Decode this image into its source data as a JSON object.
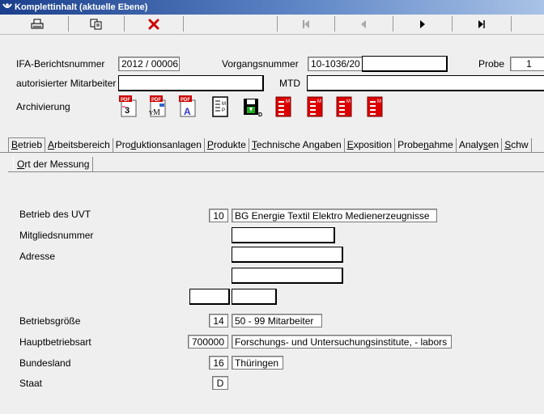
{
  "window": {
    "title": "Komplettinhalt (aktuelle Ebene)"
  },
  "toolbar": {
    "buttons": [
      "print-icon",
      "copy-record-icon",
      "delete-icon",
      "first-record-icon",
      "previous-record-icon",
      "next-record-icon",
      "last-record-icon"
    ],
    "delete_color": "#cc0000"
  },
  "header": {
    "ifa_label": "IFA-Berichtsnummer",
    "ifa_value": "2012 / 00006",
    "vorgang_label": "Vorgangsnummer",
    "vorgang_value": "10-1036/20",
    "probe_label": "Probe",
    "probe_value": "1",
    "mitarbeiter_label": "autorisierter Mitarbeiter",
    "mitarbeiter_value": "",
    "mtd_label": "MTD",
    "mtd_value": "",
    "archiv_label": "Archivierung"
  },
  "archive_icons": [
    "pdf-report-icon",
    "pdf-vm-icon",
    "pdf-a-icon",
    "document-mp-icon",
    "save-document-icon",
    "red-doc-m-icon-1",
    "red-doc-m-icon-2",
    "red-doc-m-icon-3",
    "red-doc-m-icon-4"
  ],
  "tabs": [
    {
      "label": "Betrieb",
      "u": "B",
      "rest": "etrieb"
    },
    {
      "label": "Arbeitsbereich",
      "u": "A",
      "rest": "rbeitsbereich"
    },
    {
      "label": "Produktionsanlagen",
      "pre": "Pro",
      "u": "d",
      "rest": "uktionsanlagen"
    },
    {
      "label": "Produkte",
      "u": "P",
      "rest": "rodukte"
    },
    {
      "label": "Technische Angaben",
      "u": "T",
      "rest": "echnische Angaben"
    },
    {
      "label": "Exposition",
      "u": "E",
      "rest": "xposition"
    },
    {
      "label": "Probenahme",
      "pre": "Probe",
      "u": "n",
      "rest": "ahme"
    },
    {
      "label": "Analysen",
      "pre": "Analy",
      "u": "s",
      "rest": "en"
    },
    {
      "label": "Schw",
      "u": "S",
      "rest": "chw"
    }
  ],
  "subtab": {
    "u": "O",
    "rest": "rt der Messung"
  },
  "form": {
    "betrieb_label": "Betrieb des UVT",
    "betrieb_code": "10",
    "betrieb_value": "BG Energie Textil Elektro Medienerzeugnisse",
    "mitglied_label": "Mitgliedsnummer",
    "mitglied_value": "",
    "adresse_label": "Adresse",
    "adresse_line1": "",
    "adresse_line2": "",
    "plz_value": "",
    "ort_value": "",
    "groesse_label": "Betriebsgröße",
    "groesse_code": "14",
    "groesse_value": "50 - 99 Mitarbeiter",
    "hauptart_label": "Hauptbetriebsart",
    "hauptart_code": "700000",
    "hauptart_value": "Forschungs- und Untersuchungsinstitute, - labors",
    "bundesland_label": "Bundesland",
    "bundesland_code": "16",
    "bundesland_value": "Thüringen",
    "staat_label": "Staat",
    "staat_value": "D"
  }
}
